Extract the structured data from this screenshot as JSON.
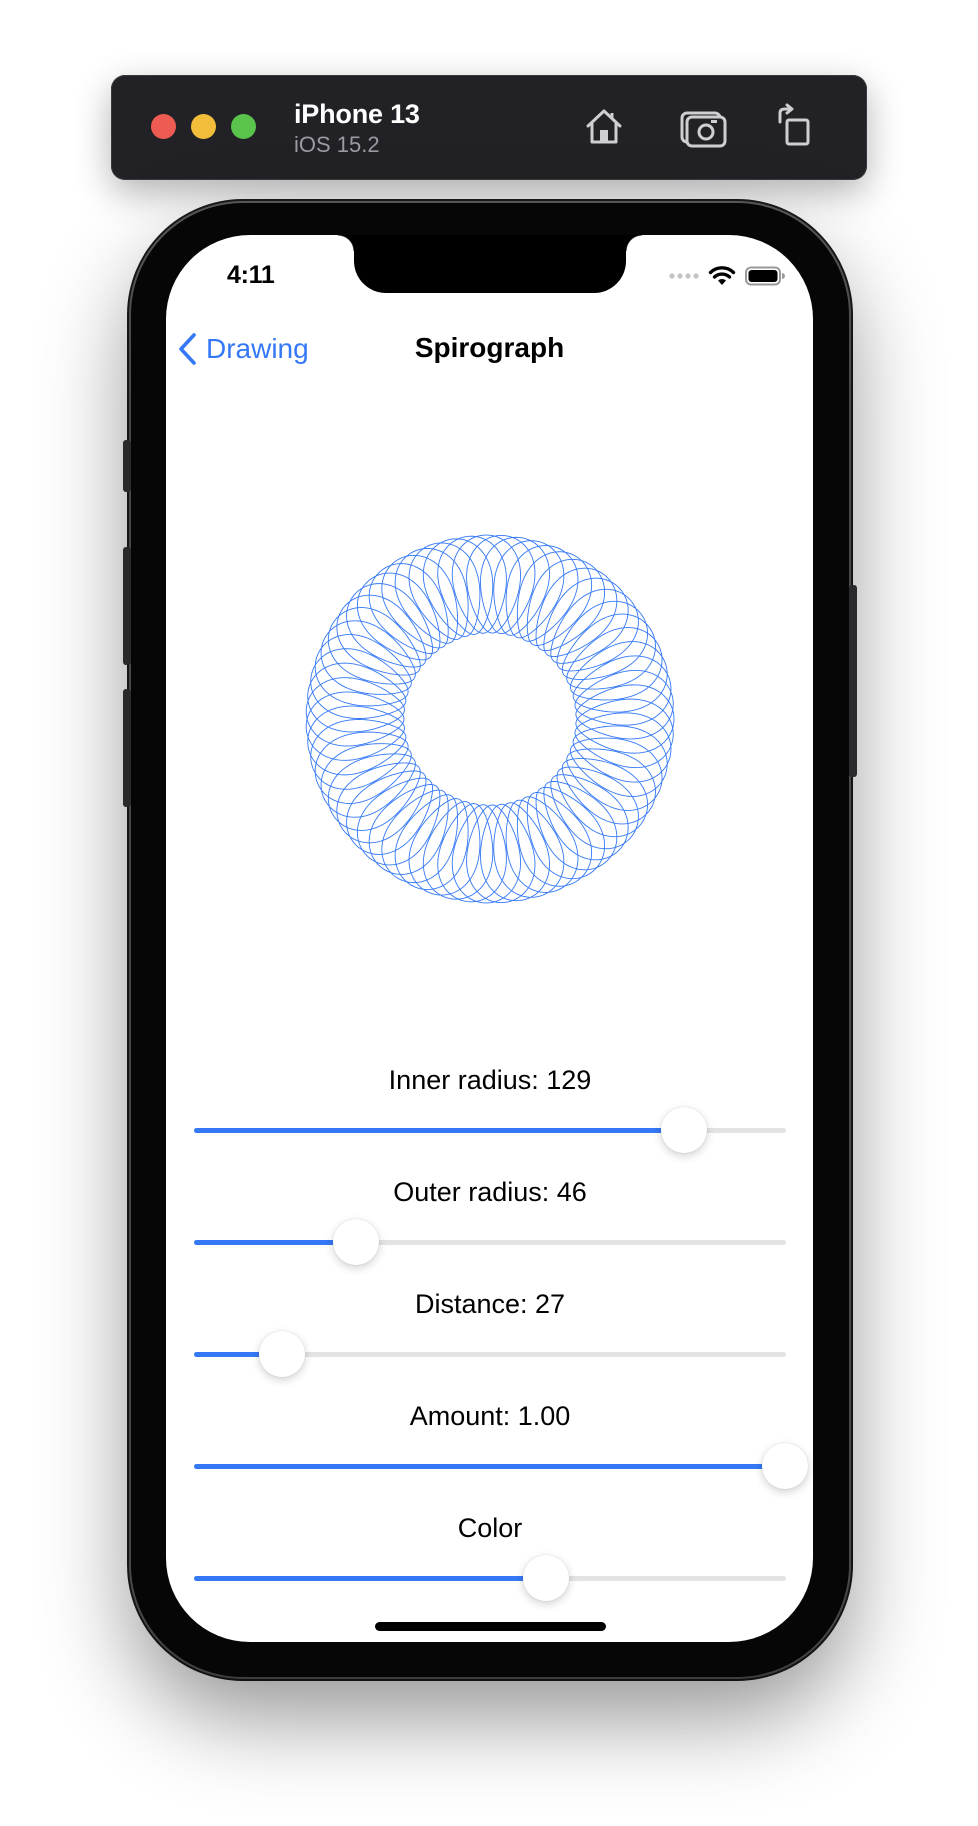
{
  "toolbar": {
    "device_name": "iPhone 13",
    "os_version": "iOS 15.2",
    "icons": [
      "home-icon",
      "screenshot-icon",
      "rotate-icon"
    ]
  },
  "status_bar": {
    "time": "4:11",
    "icons": [
      "cellular-dots-icon",
      "wifi-icon",
      "battery-icon"
    ]
  },
  "nav": {
    "back_label": "Drawing",
    "title": "Spirograph"
  },
  "spirograph": {
    "color": "#3478f6"
  },
  "controls": [
    {
      "label": "Inner radius: 129",
      "fraction": 0.827
    },
    {
      "label": "Outer radius: 46",
      "fraction": 0.274
    },
    {
      "label": "Distance: 27",
      "fraction": 0.149
    },
    {
      "label": "Amount: 1.00",
      "fraction": 1.0
    },
    {
      "label": "Color",
      "fraction": 0.594
    }
  ],
  "colors": {
    "accent": "#3478f6",
    "track": "#e3e3e6",
    "toolbar_bg": "#222226"
  }
}
